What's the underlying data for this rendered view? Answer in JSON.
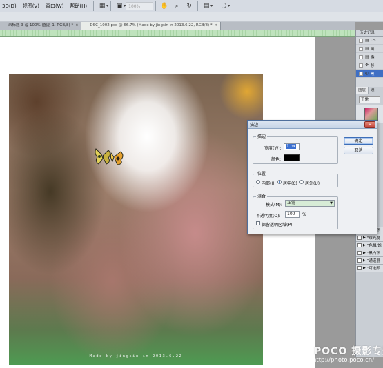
{
  "menu": {
    "items": [
      "3D(D)",
      "视图(V)",
      "窗口(W)",
      "帮助(H)"
    ],
    "zoom": "100%"
  },
  "tabs": [
    {
      "label": "未标题-3 @ 100% (图层 1, RGB/8) *",
      "active": false
    },
    {
      "label": "DSC_1002.psd @ 66.7% (Made by jingsin in 2013.6.22, RGB/8) *",
      "active": true
    }
  ],
  "photo": {
    "caption": "Made by jingsin in 2013.6.22"
  },
  "history_panel": {
    "tab": "历史记录",
    "rows": [
      {
        "label": "US"
      },
      {
        "label": "画"
      },
      {
        "label": "椭"
      },
      {
        "label": "移"
      },
      {
        "label": "黑",
        "selected": true
      }
    ]
  },
  "layers_panel": {
    "tabs": [
      "图层",
      "通"
    ],
    "blend_mode": "正常",
    "actions": [
      "\"高斯下",
      "\"曝光度",
      "\"色相/饱",
      "\"黑白下",
      "\"通道混",
      "\"可选颜"
    ]
  },
  "dialog": {
    "title": "描边",
    "stroke_group": "描边",
    "width_label": "宽度(W):",
    "width_value": "1 px",
    "color_label": "颜色:",
    "color": "#000000",
    "position_group": "位置",
    "positions": [
      {
        "label": "内部(I)",
        "selected": false
      },
      {
        "label": "居中(C)",
        "selected": true
      },
      {
        "label": "居外(U)",
        "selected": false
      }
    ],
    "blend_group": "混合",
    "mode_label": "模式(M):",
    "mode_value": "正常",
    "opacity_label": "不透明度(O):",
    "opacity_value": "100",
    "opacity_unit": "%",
    "preserve_label": "保留透明区域(P)",
    "ok_label": "确定",
    "cancel_label": "取消"
  },
  "site_watermark": {
    "main": "POCO 摄影专题",
    "url": "http://photo.poco.cn/"
  }
}
